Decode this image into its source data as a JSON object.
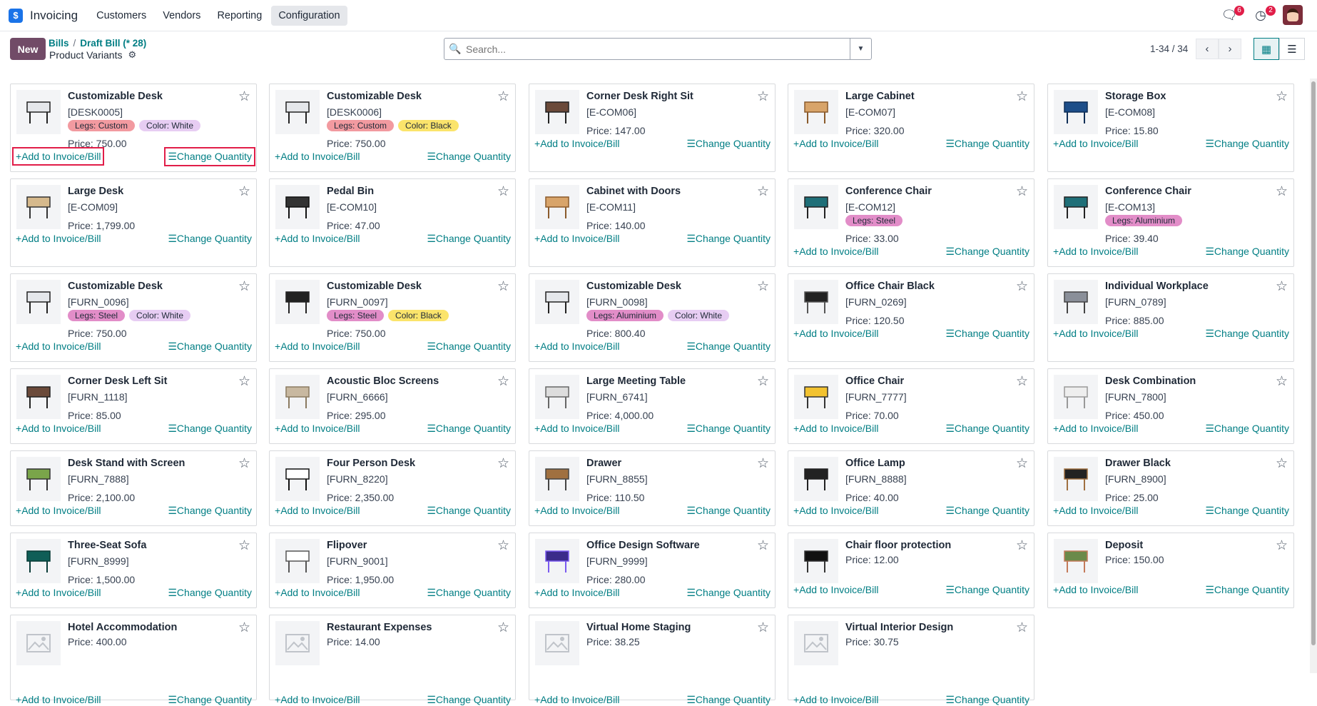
{
  "app": {
    "name": "Invoicing",
    "menu": [
      "Customers",
      "Vendors",
      "Reporting",
      "Configuration"
    ],
    "active_menu": "Configuration"
  },
  "notifications": {
    "messages": "6",
    "activities": "2"
  },
  "controls": {
    "new_label": "New",
    "breadcrumb": [
      "Bills",
      "Draft Bill (* 28)"
    ],
    "subtitle": "Product Variants",
    "search_placeholder": "Search...",
    "pager": "1-34 / 34"
  },
  "card_actions": {
    "add": "Add to Invoice/Bill",
    "change": "Change Quantity"
  },
  "tag_colors": {
    "Legs: Custom": "#f29aa0",
    "Legs: Steel": "#e28dc8",
    "Legs: Aluminium": "#e28dc8",
    "Color: White": "#e7cdf3",
    "Color: Black": "#fbe46b"
  },
  "products": [
    {
      "name": "Customizable Desk",
      "ref": "[DESK0005]",
      "tags": [
        "Legs: Custom",
        "Color: White"
      ],
      "price": "Price: 750.00",
      "icon": "desk-white"
    },
    {
      "name": "Customizable Desk",
      "ref": "[DESK0006]",
      "tags": [
        "Legs: Custom",
        "Color: Black"
      ],
      "price": "Price: 750.00",
      "icon": "desk-white"
    },
    {
      "name": "Corner Desk Right Sit",
      "ref": "[E-COM06]",
      "tags": [],
      "price": "Price: 147.00",
      "icon": "corner-desk"
    },
    {
      "name": "Large Cabinet",
      "ref": "[E-COM07]",
      "tags": [],
      "price": "Price: 320.00",
      "icon": "cabinet"
    },
    {
      "name": "Storage Box",
      "ref": "[E-COM08]",
      "tags": [],
      "price": "Price: 15.80",
      "icon": "box"
    },
    {
      "name": "Large Desk",
      "ref": "[E-COM09]",
      "tags": [],
      "price": "Price: 1,799.00",
      "icon": "desk-large"
    },
    {
      "name": "Pedal Bin",
      "ref": "[E-COM10]",
      "tags": [],
      "price": "Price: 47.00",
      "icon": "bin"
    },
    {
      "name": "Cabinet with Doors",
      "ref": "[E-COM11]",
      "tags": [],
      "price": "Price: 140.00",
      "icon": "cabinet"
    },
    {
      "name": "Conference Chair",
      "ref": "[E-COM12]",
      "tags": [
        "Legs: Steel"
      ],
      "price": "Price: 33.00",
      "icon": "chair-teal"
    },
    {
      "name": "Conference Chair",
      "ref": "[E-COM13]",
      "tags": [
        "Legs: Aluminium"
      ],
      "price": "Price: 39.40",
      "icon": "chair-teal"
    },
    {
      "name": "Customizable Desk",
      "ref": "[FURN_0096]",
      "tags": [
        "Legs: Steel",
        "Color: White"
      ],
      "price": "Price: 750.00",
      "icon": "desk-white"
    },
    {
      "name": "Customizable Desk",
      "ref": "[FURN_0097]",
      "tags": [
        "Legs: Steel",
        "Color: Black"
      ],
      "price": "Price: 750.00",
      "icon": "desk-black"
    },
    {
      "name": "Customizable Desk",
      "ref": "[FURN_0098]",
      "tags": [
        "Legs: Aluminium",
        "Color: White"
      ],
      "price": "Price: 800.40",
      "icon": "desk-white"
    },
    {
      "name": "Office Chair Black",
      "ref": "[FURN_0269]",
      "tags": [],
      "price": "Price: 120.50",
      "icon": "chair-black"
    },
    {
      "name": "Individual Workplace",
      "ref": "[FURN_0789]",
      "tags": [],
      "price": "Price: 885.00",
      "icon": "workplace"
    },
    {
      "name": "Corner Desk Left Sit",
      "ref": "[FURN_1118]",
      "tags": [],
      "price": "Price: 85.00",
      "icon": "corner-desk"
    },
    {
      "name": "Acoustic Bloc Screens",
      "ref": "[FURN_6666]",
      "tags": [],
      "price": "Price: 295.00",
      "icon": "screens"
    },
    {
      "name": "Large Meeting Table",
      "ref": "[FURN_6741]",
      "tags": [],
      "price": "Price: 4,000.00",
      "icon": "meeting-table"
    },
    {
      "name": "Office Chair",
      "ref": "[FURN_7777]",
      "tags": [],
      "price": "Price: 70.00",
      "icon": "chair-yellow"
    },
    {
      "name": "Desk Combination",
      "ref": "[FURN_7800]",
      "tags": [],
      "price": "Price: 450.00",
      "icon": "desk-combo"
    },
    {
      "name": "Desk Stand with Screen",
      "ref": "[FURN_7888]",
      "tags": [],
      "price": "Price: 2,100.00",
      "icon": "desk-stand"
    },
    {
      "name": "Four Person Desk",
      "ref": "[FURN_8220]",
      "tags": [],
      "price": "Price: 2,350.00",
      "icon": "four-desk"
    },
    {
      "name": "Drawer",
      "ref": "[FURN_8855]",
      "tags": [],
      "price": "Price: 110.50",
      "icon": "drawer"
    },
    {
      "name": "Office Lamp",
      "ref": "[FURN_8888]",
      "tags": [],
      "price": "Price: 40.00",
      "icon": "lamp"
    },
    {
      "name": "Drawer Black",
      "ref": "[FURN_8900]",
      "tags": [],
      "price": "Price: 25.00",
      "icon": "drawer-black"
    },
    {
      "name": "Three-Seat Sofa",
      "ref": "[FURN_8999]",
      "tags": [],
      "price": "Price: 1,500.00",
      "icon": "sofa"
    },
    {
      "name": "Flipover",
      "ref": "[FURN_9001]",
      "tags": [],
      "price": "Price: 1,950.00",
      "icon": "flipover"
    },
    {
      "name": "Office Design Software",
      "ref": "[FURN_9999]",
      "tags": [],
      "price": "Price: 280.00",
      "icon": "software"
    },
    {
      "name": "Chair floor protection",
      "ref": "",
      "tags": [],
      "price": "Price: 12.00",
      "icon": "floor-mat"
    },
    {
      "name": "Deposit",
      "ref": "",
      "tags": [],
      "price": "Price: 150.00",
      "icon": "deposit"
    },
    {
      "name": "Hotel Accommodation",
      "ref": "",
      "tags": [],
      "price": "Price: 400.00",
      "icon": "placeholder"
    },
    {
      "name": "Restaurant Expenses",
      "ref": "",
      "tags": [],
      "price": "Price: 14.00",
      "icon": "placeholder"
    },
    {
      "name": "Virtual Home Staging",
      "ref": "",
      "tags": [],
      "price": "Price: 38.25",
      "icon": "placeholder"
    },
    {
      "name": "Virtual Interior Design",
      "ref": "",
      "tags": [],
      "price": "Price: 30.75",
      "icon": "placeholder"
    }
  ]
}
